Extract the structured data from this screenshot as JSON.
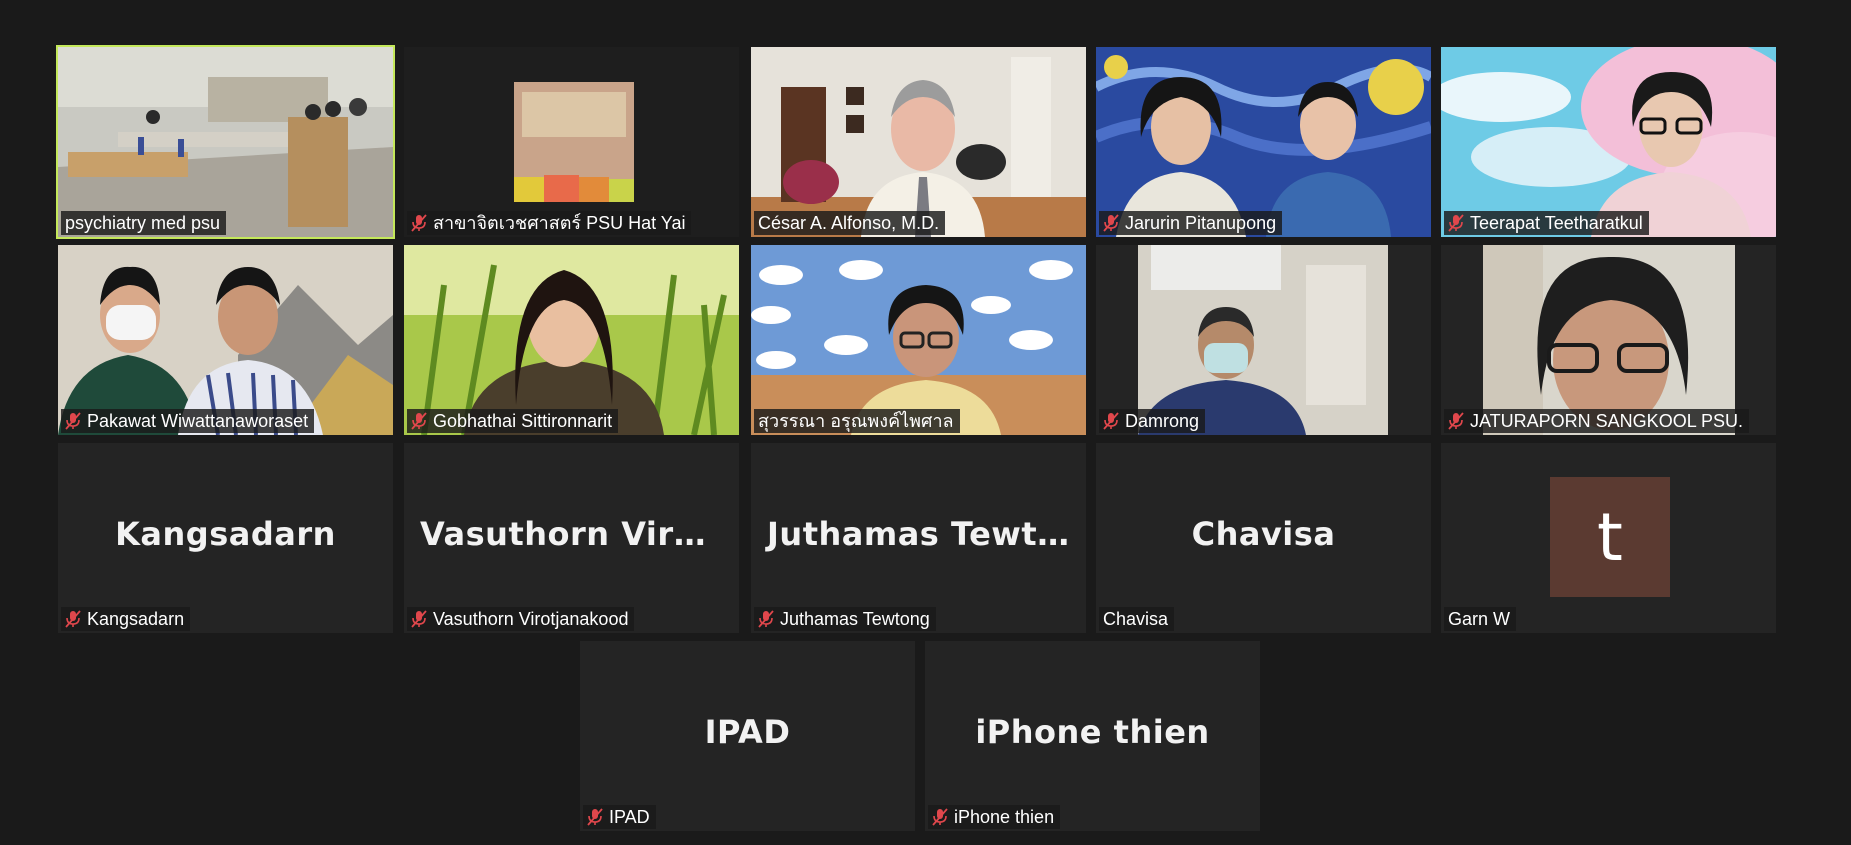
{
  "participants": [
    {
      "name": "psychiatry med psu",
      "muted": false,
      "active": true
    },
    {
      "name": "สาขาจิตเวชศาสตร์ PSU Hat Yai",
      "muted": true
    },
    {
      "name": "César A. Alfonso, M.D.",
      "muted": false
    },
    {
      "name": "Jarurin Pitanupong",
      "muted": true
    },
    {
      "name": "Teerapat Teetharatkul",
      "muted": true
    },
    {
      "name": "Pakawat Wiwattanaworaset",
      "muted": true
    },
    {
      "name": "Gobhathai Sittironnarit",
      "muted": true
    },
    {
      "name": "สุวรรณา อรุณพงค์ไพศาล",
      "muted": false
    },
    {
      "name": "Damrong",
      "muted": true
    },
    {
      "name": "JATURAPORN SANGKOOL PSU.",
      "muted": true
    },
    {
      "name": "Kangsadarn",
      "muted": true,
      "display_name": "Kangsadarn"
    },
    {
      "name": "Vasuthorn Virotjanakood",
      "muted": true,
      "display_name": "Vasuthorn  Virot..."
    },
    {
      "name": "Juthamas Tewtong",
      "muted": true,
      "display_name": "Juthamas  Tewt..."
    },
    {
      "name": "Chavisa",
      "muted": false,
      "display_name": "Chavisa"
    },
    {
      "name": "Garn W",
      "muted": false,
      "avatar_letter": "t"
    },
    {
      "name": "IPAD",
      "muted": true,
      "display_name": "IPAD"
    },
    {
      "name": "iPhone thien",
      "muted": true,
      "display_name": "iPhone thien"
    }
  ],
  "colors": {
    "background": "#1a1a1a",
    "tile": "#242424",
    "active_border": "#c4e85a",
    "muted_icon": "#e0474c",
    "avatar_bg": "#5b3a31"
  },
  "icons": {
    "muted": "microphone-muted-icon"
  }
}
